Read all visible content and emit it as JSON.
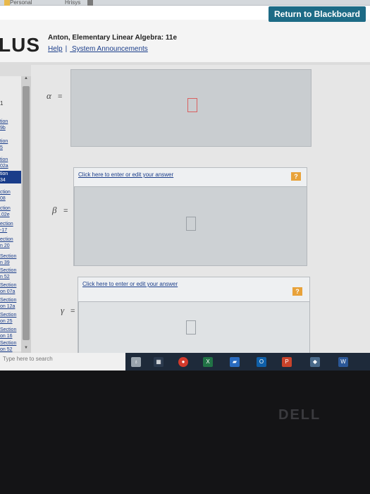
{
  "browser": {
    "tabs": [
      "Personal",
      "Hrisys"
    ]
  },
  "header": {
    "return_label": "Return to Blackboard",
    "logo_text": "LUS",
    "book_title": "Anton, Elementary Linear Algebra: 11e",
    "links": [
      "Help",
      "|",
      "System Announcements"
    ]
  },
  "sidebar": {
    "items": [
      {
        "label": "1",
        "type": "num"
      },
      {
        "label": "tion"
      },
      {
        "label": "9b"
      },
      {
        "label": "tion"
      },
      {
        "label": "5"
      },
      {
        "label": "tion"
      },
      {
        "label": "02a"
      },
      {
        "label": "tion",
        "active": true
      },
      {
        "label": "34",
        "active": true
      },
      {
        "label": "ction"
      },
      {
        "label": "08"
      },
      {
        "label": "ction"
      },
      {
        "label": ".02e"
      },
      {
        "label": "ection"
      },
      {
        "label": "-17"
      },
      {
        "label": "ection"
      },
      {
        "label": "n 20"
      },
      {
        "label": "Section"
      },
      {
        "label": "n 39"
      },
      {
        "label": "Section"
      },
      {
        "label": "n 52"
      },
      {
        "label": "Section"
      },
      {
        "label": "on 07a"
      },
      {
        "label": "Section"
      },
      {
        "label": "on 12a"
      },
      {
        "label": "Section"
      },
      {
        "label": "on 25"
      },
      {
        "label": "Section"
      },
      {
        "label": "on 16"
      },
      {
        "label": "Section"
      },
      {
        "label": "on 52"
      }
    ]
  },
  "question": {
    "alpha_symbol": "α",
    "beta_symbol": "β",
    "gamma_symbol": "γ",
    "equals": "=",
    "entry_link": "Click here to enter or edit your answer",
    "help_icon": "?"
  },
  "taskbar": {
    "search_placeholder": "Type here to search",
    "icons": [
      "microphone-icon",
      "task-view-icon",
      "chrome-icon",
      "excel-icon",
      "store-icon",
      "outlook-icon",
      "powerpoint-icon",
      "unknown-app-icon",
      "word-icon"
    ]
  },
  "bezel": {
    "brand": "DELL"
  },
  "colors": {
    "accent": "#1d6b86",
    "link": "#1a3d8a",
    "help": "#e8a23a",
    "missing_answer": "#d96060"
  }
}
